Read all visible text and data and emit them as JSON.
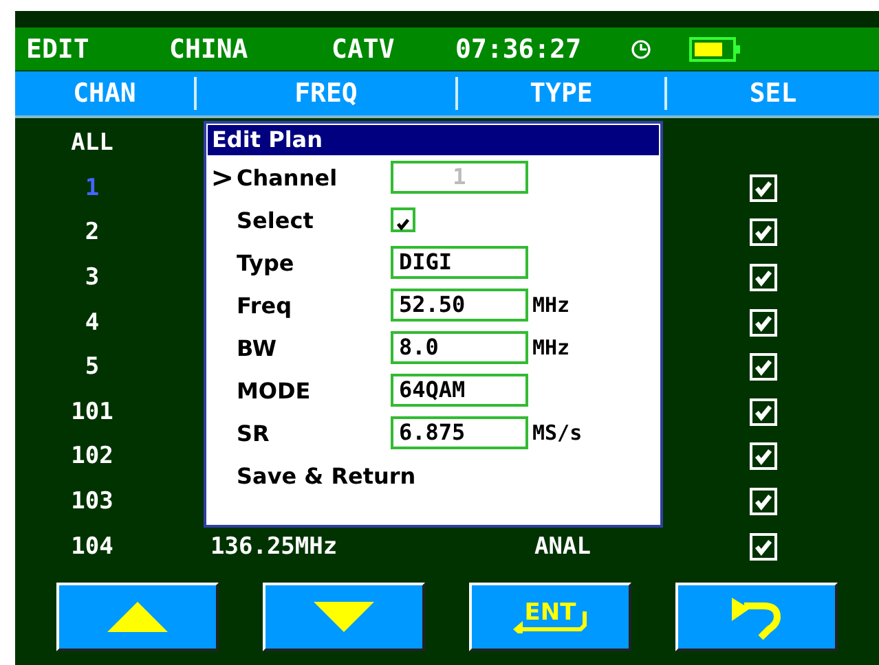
{
  "status_bar": {
    "mode": "EDIT",
    "region": "CHINA",
    "standard": "CATV",
    "time": "07:36:27"
  },
  "columns": [
    "CHAN",
    "FREQ",
    "TYPE",
    "SEL"
  ],
  "rows": [
    {
      "chan": "ALL",
      "selected": false
    },
    {
      "chan": "1",
      "selected": true,
      "checked": true
    },
    {
      "chan": "2",
      "selected": false,
      "checked": true
    },
    {
      "chan": "3",
      "selected": false,
      "checked": true
    },
    {
      "chan": "4",
      "selected": false,
      "checked": true
    },
    {
      "chan": "5",
      "selected": false,
      "checked": true
    },
    {
      "chan": "101",
      "selected": false,
      "checked": true
    },
    {
      "chan": "102",
      "selected": false,
      "checked": true
    },
    {
      "chan": "103",
      "selected": false,
      "checked": true
    },
    {
      "chan": "104",
      "freq": "136.25MHz",
      "type": "ANAL",
      "selected": false,
      "checked": true
    }
  ],
  "dialog": {
    "title": "Edit Plan",
    "cursor": ">",
    "items": [
      {
        "kind": "field",
        "label": "Channel",
        "value": "1",
        "disabled": true,
        "selected": true
      },
      {
        "kind": "checkbox",
        "label": "Select",
        "checked": true,
        "selected": false
      },
      {
        "kind": "field",
        "label": "Type",
        "value": "DIGI",
        "disabled": false,
        "selected": false
      },
      {
        "kind": "field",
        "label": "Freq",
        "value": "52.50",
        "unit": "MHz",
        "disabled": false,
        "selected": false
      },
      {
        "kind": "field",
        "label": "BW",
        "value": "8.0",
        "unit": "MHz",
        "disabled": false,
        "selected": false
      },
      {
        "kind": "field",
        "label": "MODE",
        "value": "64QAM",
        "disabled": false,
        "selected": false
      },
      {
        "kind": "field",
        "label": "SR",
        "value": "6.875",
        "unit": "MS/s",
        "disabled": false,
        "selected": false
      },
      {
        "kind": "action",
        "label": "Save & Return",
        "selected": false
      }
    ]
  },
  "buttons": [
    {
      "kind": "up"
    },
    {
      "kind": "down"
    },
    {
      "kind": "enter",
      "label": "ENT"
    },
    {
      "kind": "back"
    }
  ]
}
